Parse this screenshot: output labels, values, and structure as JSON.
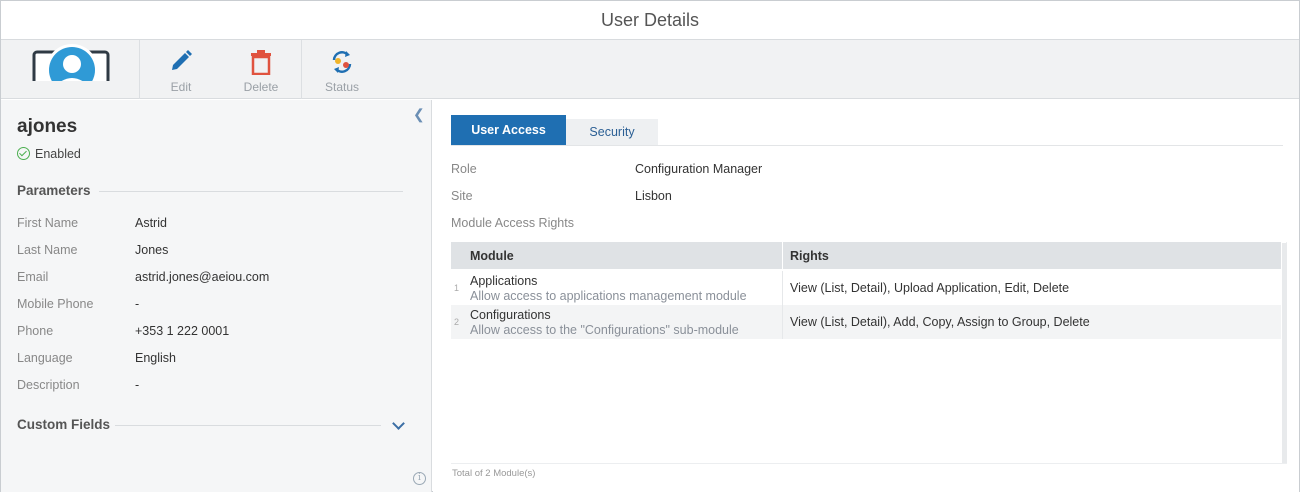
{
  "window": {
    "title": "User Details"
  },
  "toolbar": {
    "edit_label": "Edit",
    "delete_label": "Delete",
    "status_label": "Status"
  },
  "user": {
    "username": "ajones",
    "status": "Enabled"
  },
  "parameters": {
    "heading": "Parameters",
    "rows": [
      {
        "key": "First Name",
        "value": "Astrid"
      },
      {
        "key": "Last Name",
        "value": "Jones"
      },
      {
        "key": "Email",
        "value": "astrid.jones@aeiou.com"
      },
      {
        "key": "Mobile Phone",
        "value": "-"
      },
      {
        "key": "Phone",
        "value": "+353 1 222 0001"
      },
      {
        "key": "Language",
        "value": "English"
      },
      {
        "key": "Description",
        "value": "-"
      }
    ]
  },
  "custom_fields": {
    "heading": "Custom Fields"
  },
  "tabs": [
    {
      "label": "User Access",
      "active": true
    },
    {
      "label": "Security",
      "active": false
    }
  ],
  "access": {
    "role_label": "Role",
    "role_value": "Configuration Manager",
    "site_label": "Site",
    "site_value": "Lisbon",
    "module_rights_label": "Module Access Rights"
  },
  "grid": {
    "columns": [
      "Module",
      "Rights"
    ],
    "rows": [
      {
        "num": "1",
        "module": "Applications",
        "description": "Allow access to applications management module",
        "rights": "View (List, Detail), Upload Application, Edit, Delete"
      },
      {
        "num": "2",
        "module": "Configurations",
        "description": "Allow access to the \"Configurations\" sub-module",
        "rights": "View (List, Detail), Add, Copy, Assign to Group, Delete"
      }
    ],
    "footer": "Total of 2 Module(s)"
  },
  "colors": {
    "accent": "#1f6fb2",
    "delete": "#e0533f",
    "enabled": "#4caf50"
  },
  "icons": [
    "user-avatar-icon",
    "edit-icon",
    "delete-icon",
    "status-icon",
    "collapse-left-icon",
    "check-circle-icon",
    "chevron-down-icon",
    "info-icon"
  ]
}
